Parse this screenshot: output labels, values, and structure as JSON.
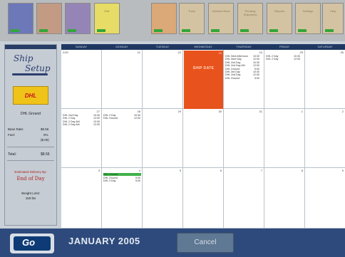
{
  "top_tiles": [
    {
      "label": "",
      "color": "#6d78b8"
    },
    {
      "label": "",
      "color": "#c39b84"
    },
    {
      "label": "",
      "color": "#9585b7"
    },
    {
      "label": "Edit",
      "color": "#e7dc66"
    },
    {
      "label": "",
      "color": "#dba878"
    },
    {
      "label": "Track",
      "color": "#d4c3a2"
    },
    {
      "label": "Address Book",
      "color": "#d4c3a2"
    },
    {
      "label": "Pending Shipments",
      "color": "#d4c3a2"
    },
    {
      "label": "Reports",
      "color": "#d4c3a2"
    },
    {
      "label": "Settings",
      "color": "#d4c3a2"
    },
    {
      "label": "Help",
      "color": "#d4c3a2"
    }
  ],
  "sidebar": {
    "logo_line1": "Ship",
    "logo_line2": "Setup",
    "carrier_logo": "DHL",
    "carrier_name": "DHL Ground",
    "base_rate_label": "Base Rate:",
    "base_rate_value": "$8.56",
    "fuel_label": "Fuel:",
    "fuel_pct": "0%",
    "fuel_value": "($.00)",
    "total_label": "Total:",
    "total_value": "$8.56",
    "est_delivery_label": "Estimated Delivery By:",
    "est_delivery_value": "End of Day",
    "weight_label": "Weight Limit:",
    "weight_value": "150 lbs"
  },
  "calendar": {
    "day_names": [
      "SUNDAY",
      "MONDAY",
      "TUESDAY",
      "WEDNESDAY",
      "THURSDAY",
      "FRIDAY",
      "SATURDAY"
    ],
    "week1": [
      "2/20",
      "21",
      "22",
      "23",
      "24",
      "25",
      "26"
    ],
    "week2": [
      "27",
      "28",
      "29",
      "30",
      "31",
      "1",
      "2"
    ],
    "week3": [
      "3",
      "4",
      "5",
      "6",
      "7",
      "8",
      "9"
    ],
    "ship_date_label": "SHIP DATE",
    "friday_events": [
      {
        "text": "DHL Next Afternoon",
        "time": "10:30"
      },
      {
        "text": "DHL Next Day",
        "time": "12:00"
      },
      {
        "text": "DHL 2nd Day",
        "time": "10:30"
      },
      {
        "text": "DHL 2nd Day AM",
        "time": "12:00"
      },
      {
        "text": "DHL Ground",
        "time": "5:00"
      },
      {
        "text": "DHL 3rd Day",
        "time": "10:30"
      },
      {
        "text": "DHL 2nd Day",
        "time": "12:00"
      },
      {
        "text": "DHL Ground",
        "time": "5:00"
      }
    ],
    "saturday_events": [
      {
        "text": "DHL 2 Day",
        "time": "10:30"
      },
      {
        "text": "DHL 2 Day",
        "time": "12:00"
      }
    ],
    "week2_sunday_events": [
      {
        "text": "DHL 2nd Day",
        "time": "10:30"
      },
      {
        "text": "DHL 2 Day",
        "time": "12:00"
      },
      {
        "text": "DHL 2 Day AM",
        "time": "10:30"
      },
      {
        "text": "DHL 2 Day AM",
        "time": "12:00"
      }
    ],
    "week2_monday_events": [
      {
        "text": "DHL 2 Day",
        "time": "10:30"
      },
      {
        "text": "DHL Ground",
        "time": "12:00"
      }
    ],
    "week3_monday_events": [
      {
        "text": "DHL Ground",
        "time": "",
        "highlight": true
      },
      {
        "text": "DHL Ground",
        "time": "5:00"
      },
      {
        "text": "DHL 3 Day",
        "time": "5:00"
      }
    ]
  },
  "bottom": {
    "month_title": "JANUARY 2005",
    "cancel_label": "Cancel",
    "home_label": "Go"
  },
  "colors": {
    "ship_date": "#e8521c",
    "header_navy": "#1f3862",
    "bottom_bar": "#2e4a7c"
  }
}
